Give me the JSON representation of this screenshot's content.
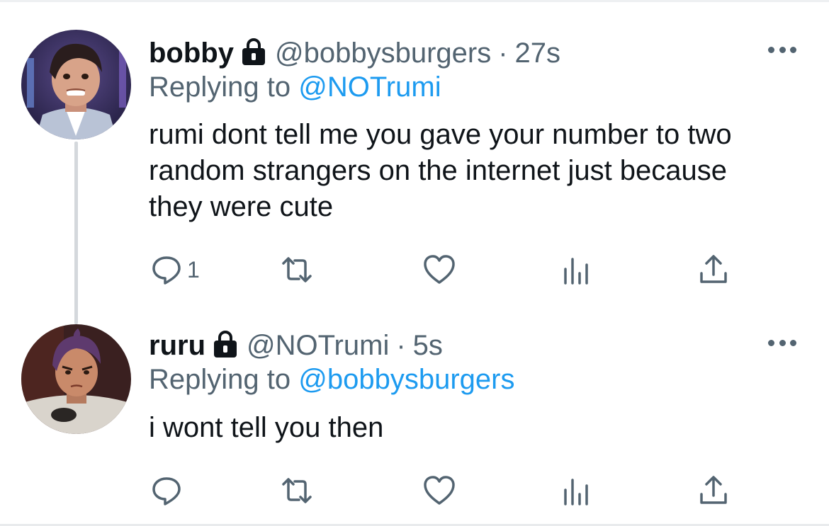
{
  "tweets": [
    {
      "name": "bobby",
      "handle": "@bobbysburgers",
      "separator": "·",
      "time": "27s",
      "replying_prefix": "Replying to",
      "replying_to": "@NOTrumi",
      "text": "rumi dont tell me you gave your number to two random strangers on the internet just because they were cute",
      "reply_count": "1",
      "avatar_icon": "avatar-cartoon-boy",
      "verified_lock_icon": "lock-icon"
    },
    {
      "name": "ruru",
      "handle": "@NOTrumi",
      "separator": "·",
      "time": "5s",
      "replying_prefix": "Replying to",
      "replying_to": "@bobbysburgers",
      "text": "i wont tell you then",
      "reply_count": "",
      "avatar_icon": "avatar-cartoon-girl",
      "verified_lock_icon": "lock-icon"
    }
  ],
  "colors": {
    "text": "#0f1419",
    "secondary": "#536471",
    "link": "#1d9bf0",
    "thread_line": "#d4d8dc"
  }
}
